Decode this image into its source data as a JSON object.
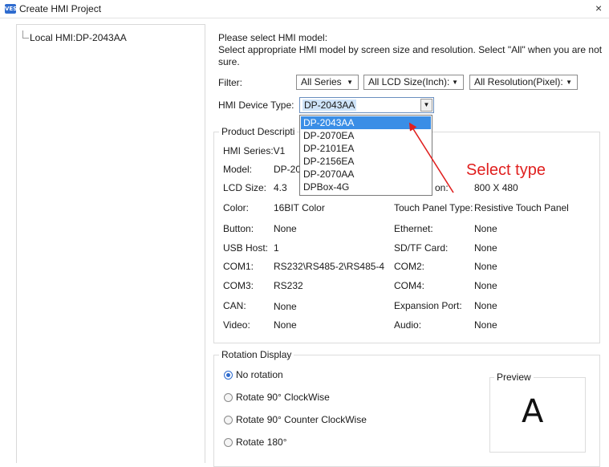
{
  "window": {
    "logo_text": "VES",
    "title": "Create HMI Project",
    "close_glyph": "×"
  },
  "tree": {
    "item": "Local HMI:DP-2043AA"
  },
  "instructions": {
    "line1": "Please select HMI model:",
    "line2": "Select appropriate HMI model by screen size and resolution. Select \"All\" when you are not",
    "line3": "sure."
  },
  "filter": {
    "label": "Filter:",
    "series": "All Series",
    "lcd_size": "All LCD Size(Inch):",
    "resolution": "All Resolution(Pixel):"
  },
  "device_type": {
    "label": "HMI Device Type:",
    "value": "DP-2043AA",
    "options": [
      "DP-2043AA",
      "DP-2070EA",
      "DP-2101EA",
      "DP-2156EA",
      "DP-2070AA",
      "DPBox-4G"
    ],
    "selected_index": 0
  },
  "product": {
    "title": "Product Descripti",
    "series": "HMI Series:V1",
    "model_label": "Model:",
    "model_value": "DP-20",
    "lcd_label": "LCD Size:",
    "lcd_value": "4.3",
    "resolution_label_partial": "on:",
    "resolution_value": "800 X 480",
    "color_label": "Color:",
    "color_value": "16BIT Color",
    "touch_label": "Touch Panel Type:",
    "touch_value": "Resistive Touch Panel",
    "button_label": "Button:",
    "button_value": "None",
    "ethernet_label": "Ethernet:",
    "ethernet_value": "None",
    "usb_label": "USB Host:",
    "usb_value": "1",
    "sd_label": "SD/TF Card:",
    "sd_value": "None",
    "com1_label": "COM1:",
    "com1_value": "RS232\\RS485-2\\RS485-4",
    "com2_label": "COM2:",
    "com2_value": "None",
    "com3_label": "COM3:",
    "com3_value": "RS232",
    "com4_label": "COM4:",
    "com4_value": "None",
    "can_label": "CAN:",
    "can_value": "None",
    "expansion_label": "Expansion Port:",
    "expansion_value": "None",
    "video_label": "Video:",
    "video_value": "None",
    "audio_label": "Audio:",
    "audio_value": "None"
  },
  "annotation": {
    "text": "Select type",
    "color": "#e0201f"
  },
  "rotation": {
    "title": "Rotation Display",
    "options": [
      "No rotation",
      "Rotate 90° ClockWise",
      "Rotate 90° Counter ClockWise",
      "Rotate 180°"
    ],
    "selected_index": 0
  },
  "preview": {
    "title": "Preview",
    "letter": "A"
  }
}
